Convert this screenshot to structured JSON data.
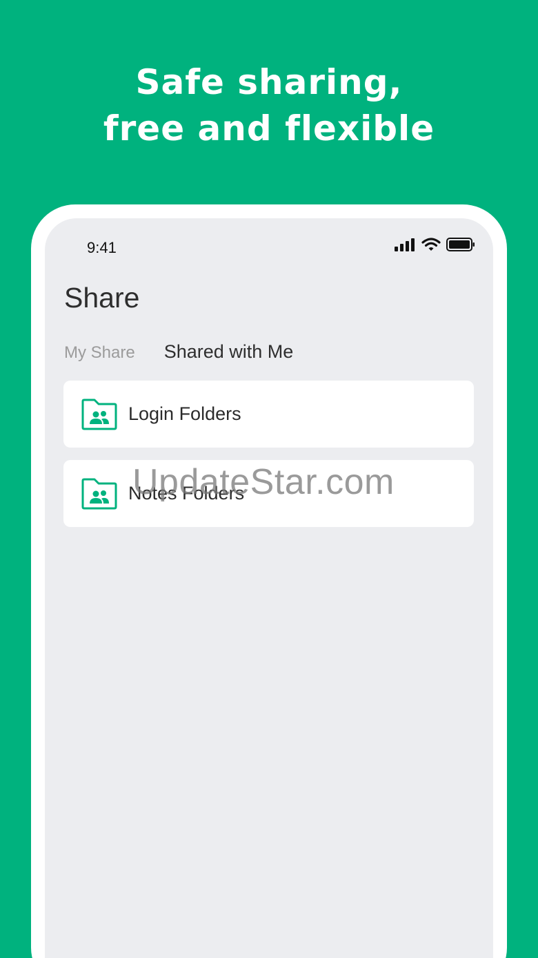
{
  "headline": {
    "line1": "Safe sharing,",
    "line2": "free and flexible"
  },
  "status_bar": {
    "time": "9:41",
    "icons": [
      "signal-icon",
      "wifi-icon",
      "battery-icon"
    ]
  },
  "page": {
    "title": "Share"
  },
  "tabs": [
    {
      "label": "My Share",
      "active": false
    },
    {
      "label": "Shared with Me",
      "active": true
    }
  ],
  "folders": [
    {
      "label": "Login Folders",
      "icon": "shared-folder-icon"
    },
    {
      "label": "Notes Folders",
      "icon": "shared-folder-icon"
    }
  ],
  "watermark": "UpdateStar.com",
  "colors": {
    "brand": "#00b27e",
    "screen_bg": "#ecedf0",
    "card_bg": "#ffffff"
  }
}
